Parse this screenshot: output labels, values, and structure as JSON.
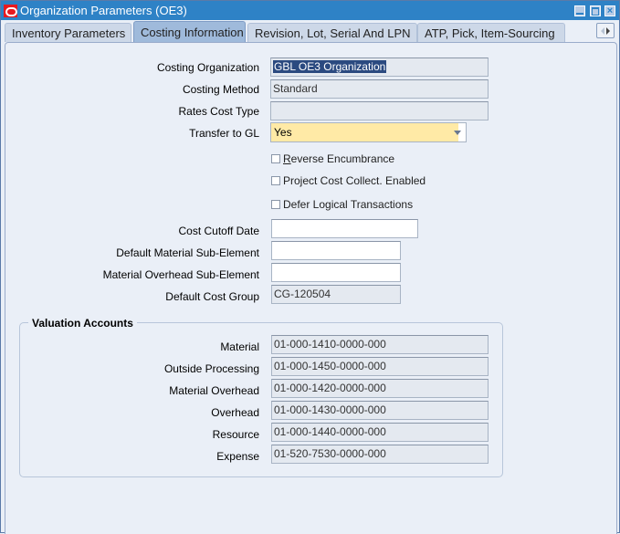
{
  "window": {
    "title": "Organization Parameters (OE3)",
    "controls": [
      "minimize-icon",
      "maximize-icon",
      "close-icon"
    ]
  },
  "tabs": [
    {
      "label": "Inventory Parameters",
      "active": false
    },
    {
      "label": "Costing Information",
      "active": true
    },
    {
      "label": "Revision, Lot, Serial And LPN",
      "active": false
    },
    {
      "label": "ATP, Pick, Item-Sourcing",
      "active": false
    }
  ],
  "form": {
    "costing_organization": {
      "label": "Costing Organization",
      "value": "GBL OE3 Organization"
    },
    "costing_method": {
      "label": "Costing Method",
      "value": "Standard"
    },
    "rates_cost_type": {
      "label": "Rates Cost Type",
      "value": ""
    },
    "transfer_to_gl": {
      "label": "Transfer to GL",
      "value": "Yes"
    },
    "checkboxes": {
      "reverse_encumbrance": {
        "label_mnemonic": "R",
        "label_rest": "everse Encumbrance",
        "checked": false
      },
      "project_cost_collect": {
        "label": "Project Cost Collect. Enabled",
        "checked": false
      },
      "defer_logical": {
        "label": "Defer Logical Transactions",
        "checked": false
      }
    },
    "cost_cutoff_date": {
      "label": "Cost Cutoff Date",
      "value": ""
    },
    "default_material_sub_element": {
      "label": "Default Material Sub-Element",
      "value": ""
    },
    "material_overhead_sub_element": {
      "label": "Material Overhead Sub-Element",
      "value": ""
    },
    "default_cost_group": {
      "label": "Default Cost Group",
      "value": "CG-120504"
    }
  },
  "valuation_accounts": {
    "title": "Valuation Accounts",
    "rows": [
      {
        "label": "Material",
        "value": "01-000-1410-0000-000"
      },
      {
        "label": "Outside Processing",
        "value": "01-000-1450-0000-000"
      },
      {
        "label": "Material Overhead",
        "value": "01-000-1420-0000-000"
      },
      {
        "label": "Overhead",
        "value": "01-000-1430-0000-000"
      },
      {
        "label": "Resource",
        "value": "01-000-1440-0000-000"
      },
      {
        "label": "Expense",
        "value": "01-520-7530-0000-000"
      }
    ]
  }
}
